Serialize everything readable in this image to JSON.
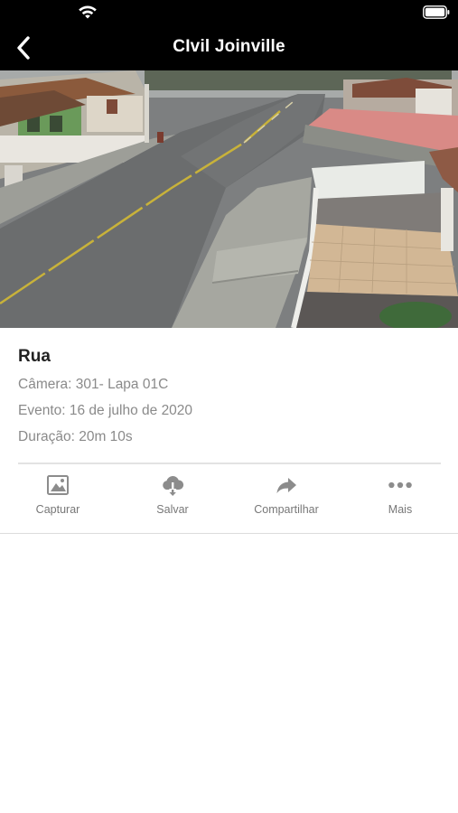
{
  "status_bar": {
    "icons": [
      "wifi-icon",
      "battery-icon"
    ]
  },
  "nav": {
    "title": "CIvil Joinville",
    "back_icon": "chevron-left-icon"
  },
  "video": {
    "description_icon": "camera-feed-image"
  },
  "details": {
    "title": "Rua",
    "camera": "Câmera: 301- Lapa 01C",
    "event": "Evento: 16 de julho de 2020",
    "duration": "Duração: 20m 10s"
  },
  "actions": [
    {
      "label": "Capturar",
      "icon": "image-icon"
    },
    {
      "label": "Salvar",
      "icon": "cloud-download-icon"
    },
    {
      "label": "Compartilhar",
      "icon": "share-arrow-icon"
    },
    {
      "label": "Mais",
      "icon": "more-dots-icon"
    }
  ],
  "colors": {
    "nav_bg": "#000000",
    "text_primary": "#222222",
    "text_secondary": "#8a8a8a",
    "icon_gray": "#8c8c8c"
  }
}
